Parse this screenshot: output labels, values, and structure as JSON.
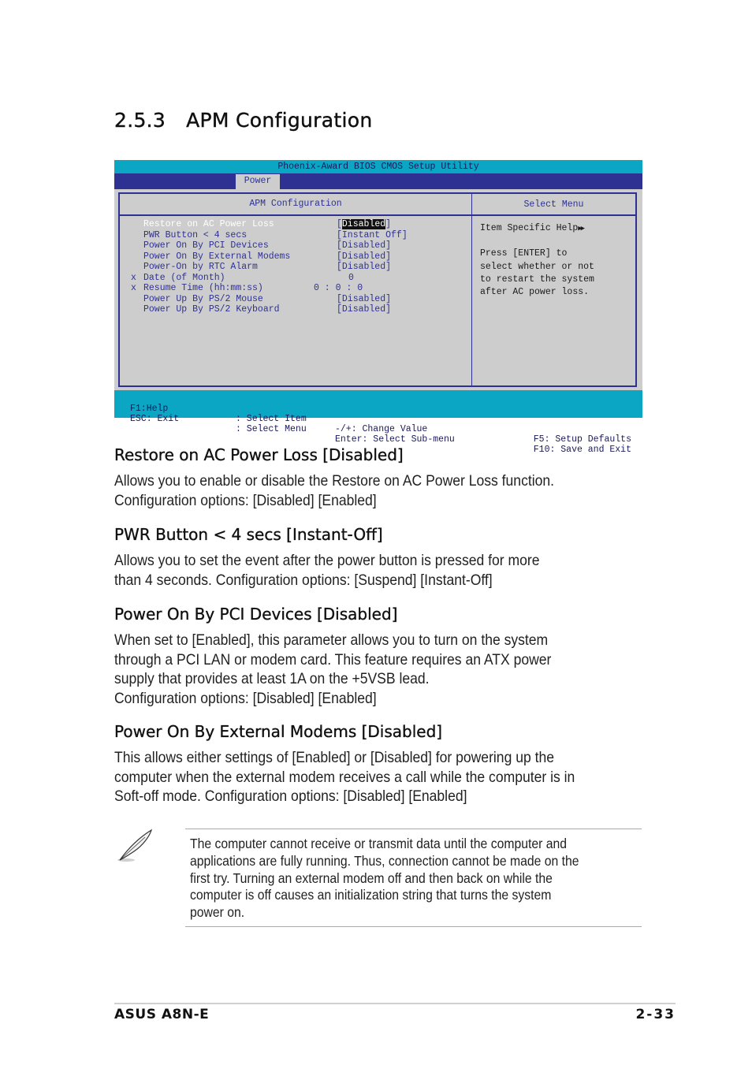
{
  "section": {
    "number": "2.5.3",
    "title": "APM Configuration"
  },
  "bios": {
    "title": "Phoenix-Award BIOS CMOS Setup Utility",
    "active_tab": "Power",
    "left_header": "APM Configuration",
    "right_header": "Select Menu",
    "items": [
      {
        "mark": "",
        "label": "Restore on AC Power Loss",
        "value": "Disabled",
        "selected": true
      },
      {
        "mark": "",
        "label": "PWR Button < 4 secs",
        "value": "[Instant Off]"
      },
      {
        "mark": "",
        "label": "Power On By PCI Devices",
        "value": "[Disabled]"
      },
      {
        "mark": "",
        "label": "Power On By External Modems",
        "value": "[Disabled]"
      },
      {
        "mark": "",
        "label": "Power-On by RTC Alarm",
        "value": "[Disabled]"
      },
      {
        "mark": "x",
        "label": "Date (of Month)",
        "value": "0"
      },
      {
        "mark": "x",
        "label": "Resume Time (hh:mm:ss)",
        "value": "0 : 0 : 0"
      },
      {
        "mark": "",
        "label": "Power Up By PS/2 Mouse",
        "value": "[Disabled]"
      },
      {
        "mark": "",
        "label": "Power Up By PS/2 Keyboard",
        "value": "[Disabled]"
      }
    ],
    "help": {
      "title": "Item Specific Help",
      "lines": [
        "Press [ENTER] to",
        "select whether or not",
        "to restart the system",
        "after AC power loss."
      ]
    },
    "footer": {
      "row1": [
        "F1:Help",
        ": Select Item",
        "-/+: Change Value",
        "F5: Setup Defaults"
      ],
      "row2": [
        "ESC: Exit",
        ": Select Menu",
        "Enter: Select Sub-menu",
        "F10: Save and Exit"
      ]
    },
    "colors": {
      "cyan": "#0ba6c4",
      "navy": "#2e3192",
      "gray": "#cdcdcd"
    }
  },
  "sections": [
    {
      "heading": "Restore on AC Power Loss [Disabled]",
      "lines": [
        "Allows you to enable or disable the Restore on AC Power Loss function.",
        "Configuration options: [Disabled] [Enabled]"
      ]
    },
    {
      "heading": "PWR Button < 4 secs [Instant-Off]",
      "lines": [
        "Allows you to set the event after the power button is pressed for more",
        "than 4 seconds. Configuration options: [Suspend] [Instant-Off]"
      ]
    },
    {
      "heading": "Power On By PCI Devices [Disabled]",
      "lines": [
        "When set to [Enabled], this parameter allows you to turn on the system",
        "through a PCI LAN or modem card. This feature requires an ATX power",
        "supply that provides at least 1A on the +5VSB lead.",
        "Configuration options: [Disabled] [Enabled]"
      ]
    },
    {
      "heading": "Power On By External Modems [Disabled]",
      "lines": [
        "This allows either settings of [Enabled] or [Disabled] for powering up the",
        "computer when the external modem receives a call while the computer is in",
        "Soft-off mode. Configuration options: [Disabled] [Enabled]"
      ]
    }
  ],
  "note": {
    "icon": "feather-pen-icon",
    "lines": [
      "The computer cannot receive or transmit data until the computer and",
      "applications are fully running. Thus, connection cannot be made on the",
      "first try. Turning an external modem off and then back on while the",
      "computer is off causes an initialization string that turns the system",
      "power on."
    ]
  },
  "footer": {
    "product": "ASUS A8N-E",
    "page": "2-33"
  }
}
